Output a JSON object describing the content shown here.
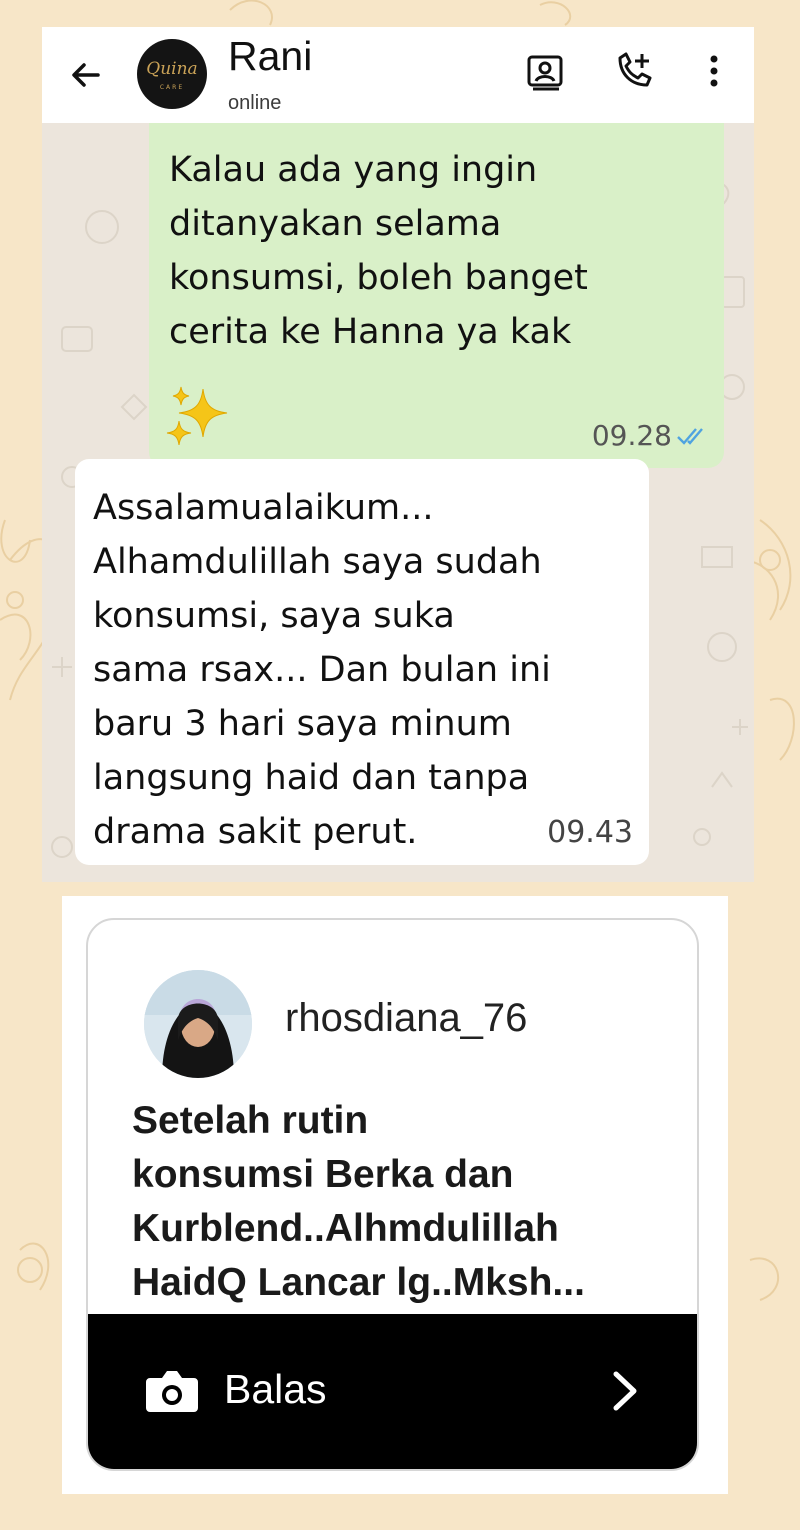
{
  "chat": {
    "contact_name": "Rani",
    "status": "online",
    "avatar_logo_text": "Quina",
    "avatar_logo_subtext": "CARE",
    "icons": {
      "back": "arrow-left-icon",
      "video_call": "video-call-icon",
      "voice_call": "add-call-icon",
      "menu": "more-vert-icon"
    }
  },
  "messages": [
    {
      "direction": "outgoing",
      "text": "Kalau ada yang ingin\nditanyakan selama\nkonsumsi, boleh banget\ncerita ke Hanna ya kak",
      "emoji": "sparkles",
      "time": "09.28",
      "ticks": "read"
    },
    {
      "direction": "incoming",
      "text": "Assalamualaikum...\nAlhamdulillah saya sudah\nkonsumsi, saya suka\nsama rsax... Dan bulan ini\nbaru 3 hari saya minum\nlangsung haid dan tanpa\ndrama sakit perut.",
      "time": "09.43"
    }
  ],
  "instagram": {
    "username": "rhosdiana_76",
    "comment": "Setelah rutin\nkonsumsi Berka dan\nKurblend..Alhmdulillah\nHaidQ Lancar lg..Mksh...",
    "reply_label": "Balas",
    "icons": {
      "camera": "camera-icon",
      "next": "chevron-right-icon"
    }
  },
  "colors": {
    "page_background": "#f7e6c8",
    "outgoing_bubble": "#d9f0c8",
    "incoming_bubble": "#ffffff",
    "read_ticks": "#4fa3e0",
    "reply_bar": "#000000"
  }
}
